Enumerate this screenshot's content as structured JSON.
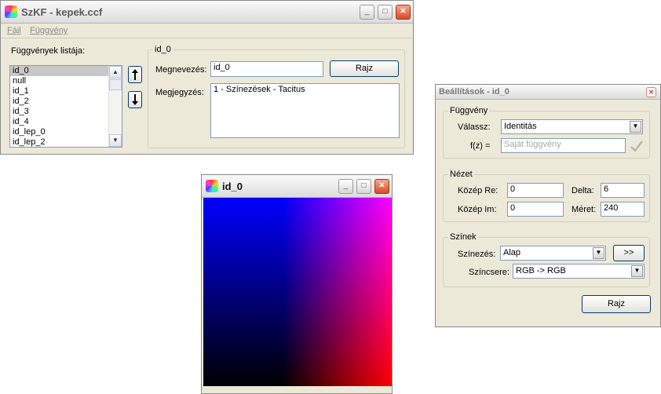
{
  "main_window": {
    "title": "SzKF - kepek.ccf",
    "menu": [
      "Fájl",
      "Függvény"
    ],
    "list_label": "Függvények listája:",
    "functions": [
      "id_0",
      "null",
      "id_1",
      "id_2",
      "id_3",
      "id_4",
      "id_lep_0",
      "id_lep_2"
    ],
    "selected_function": "id_0",
    "group_title": "id_0",
    "name_label": "Megnevezés:",
    "name_value": "id_0",
    "draw_label": "Rajz",
    "note_label": "Megjegyzés:",
    "note_value": "1 - Színezések - Tacitus",
    "move_up_icon": "arrow-up-icon",
    "move_down_icon": "arrow-down-icon"
  },
  "image_window": {
    "title": "id_0",
    "gradient_colors": {
      "top_left": "#0000ff",
      "top_right": "#ff00ff",
      "bottom_left": "#000000",
      "bottom_right": "#ff0000"
    }
  },
  "settings_window": {
    "title": "Beállítások - id_0",
    "function_group": "Függvény",
    "choose_label": "Válassz:",
    "choose_value": "Identitás",
    "fz_label": "f(z) =",
    "fz_placeholder": "Saját függvény",
    "view_group": "Nézet",
    "center_re_label": "Közép Re:",
    "center_re_value": "0",
    "delta_label": "Delta:",
    "delta_value": "6",
    "center_im_label": "Közép Im:",
    "center_im_value": "0",
    "size_label": "Méret:",
    "size_value": "240",
    "colors_group": "Színek",
    "coloring_label": "Színezés:",
    "coloring_value": "Alap",
    "more_label": ">>",
    "swap_label": "Színcsere:",
    "swap_value": "RGB -> RGB",
    "draw_label": "Rajz"
  },
  "titlebar": {
    "minimize": "_",
    "maximize": "□",
    "close": "✕"
  }
}
